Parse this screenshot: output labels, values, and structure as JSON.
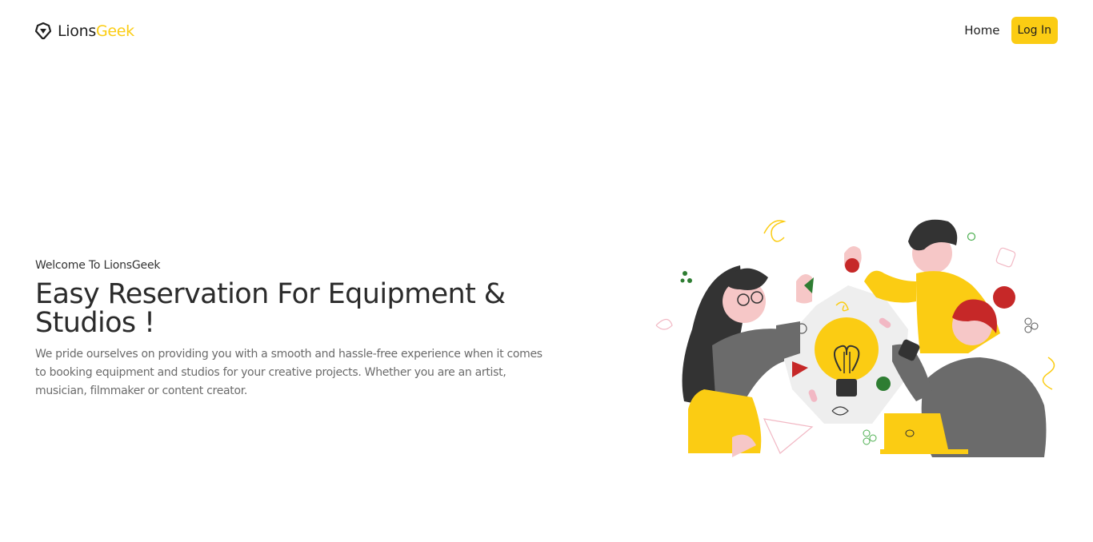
{
  "header": {
    "logo": {
      "icon": "lion-shield-icon",
      "text_part1": "Lions",
      "text_part2": "Geek"
    },
    "nav": {
      "home": "Home",
      "login": "Log In"
    }
  },
  "hero": {
    "welcome": "Welcome To LionsGeek",
    "title": "Easy Reservation For Equipment & Studios !",
    "description": "We pride ourselves on providing you with a smooth and hassle-free experience when it comes to booking equipment and studios for your creative projects. Whether you are an artist, musician, filmmaker or content creator."
  },
  "illustration": {
    "icon": "team-idea-lightbulb-illustration"
  },
  "colors": {
    "accent": "#fbcc13",
    "text_dark": "#1f1f1f",
    "text_muted": "#6b6b6b",
    "background": "#ffffff"
  }
}
